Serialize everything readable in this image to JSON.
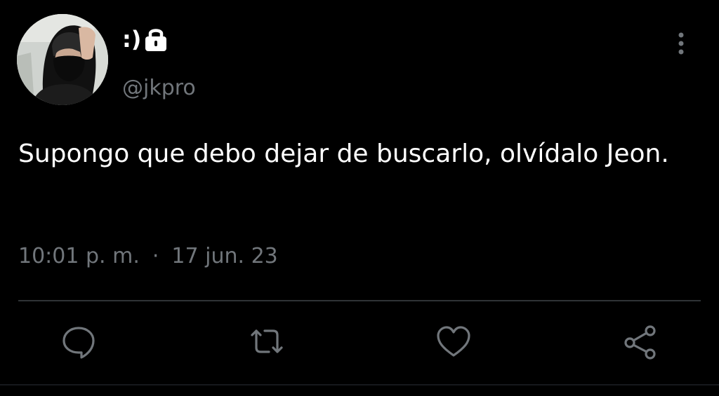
{
  "user": {
    "display_name": ":)",
    "handle": "@jkpro",
    "protected_icon": "lock-icon",
    "avatar_icon": "profile-photo"
  },
  "tweet": {
    "text": "Supongo que debo dejar de buscarlo, olvídalo Jeon.",
    "time": "10:01 p. m.",
    "separator": "·",
    "date": "17 jun. 23"
  },
  "actions": [
    {
      "name": "reply",
      "icon": "speech-bubble-icon"
    },
    {
      "name": "retweet",
      "icon": "retweet-icon"
    },
    {
      "name": "like",
      "icon": "heart-icon"
    },
    {
      "name": "share",
      "icon": "share-icon"
    }
  ],
  "menu_icon": "more-vertical-icon",
  "colors": {
    "background": "#000000",
    "text_primary": "#ffffff",
    "text_secondary": "#71767b",
    "divider": "#2f3336"
  }
}
